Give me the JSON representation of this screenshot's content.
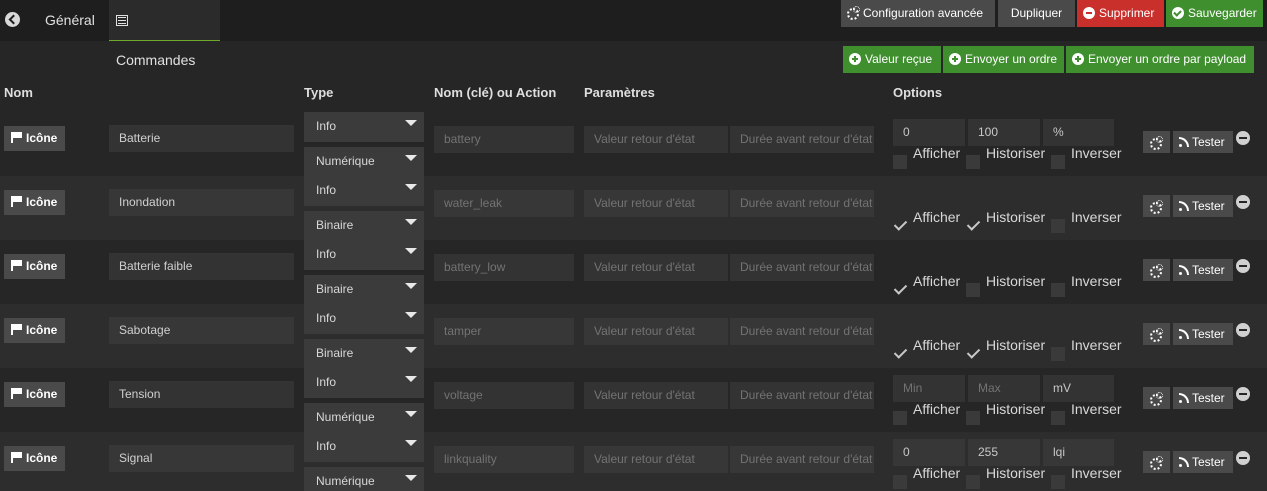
{
  "tabs": {
    "general": "Général",
    "commandes": "Commandes"
  },
  "toolbar": {
    "advanced": "Configuration avancée",
    "duplicate": "Dupliquer",
    "delete": "Supprimer",
    "save": "Sauvegarder"
  },
  "actions": {
    "received_value": "Valeur reçue",
    "send_order": "Envoyer un ordre",
    "send_payload": "Envoyer un ordre par payload"
  },
  "headers": {
    "name": "Nom",
    "type": "Type",
    "key": "Nom (clé) ou Action",
    "params": "Paramètres",
    "options": "Options"
  },
  "common": {
    "icon_label": "Icône",
    "test_label": "Tester",
    "show_label": "Afficher",
    "history_label": "Historiser",
    "invert_label": "Inverser",
    "return_value_ph": "Valeur retour d'état",
    "return_delay_ph": "Durée avant retour d'état",
    "min_ph": "Min",
    "max_ph": "Max"
  },
  "rows": [
    {
      "name": "Batterie",
      "type": "Info",
      "subtype": "Numérique",
      "key": "battery",
      "min": "0",
      "max": "100",
      "unit": "%",
      "show": false,
      "history": false,
      "invert": false
    },
    {
      "name": "Inondation",
      "type": "Info",
      "subtype": "Binaire",
      "key": "water_leak",
      "show": true,
      "history": true,
      "invert": false
    },
    {
      "name": "Batterie faible",
      "type": "Info",
      "subtype": "Binaire",
      "key": "battery_low",
      "show": true,
      "history": false,
      "invert": false
    },
    {
      "name": "Sabotage",
      "type": "Info",
      "subtype": "Binaire",
      "key": "tamper",
      "show": true,
      "history": true,
      "invert": false
    },
    {
      "name": "Tension",
      "type": "Info",
      "subtype": "Numérique",
      "key": "voltage",
      "min": "",
      "max": "",
      "unit": "mV",
      "show": false,
      "history": false,
      "invert": false
    },
    {
      "name": "Signal",
      "type": "Info",
      "subtype": "Numérique",
      "key": "linkquality",
      "min": "0",
      "max": "255",
      "unit": "lqi",
      "show": false,
      "history": false,
      "invert": false
    }
  ]
}
